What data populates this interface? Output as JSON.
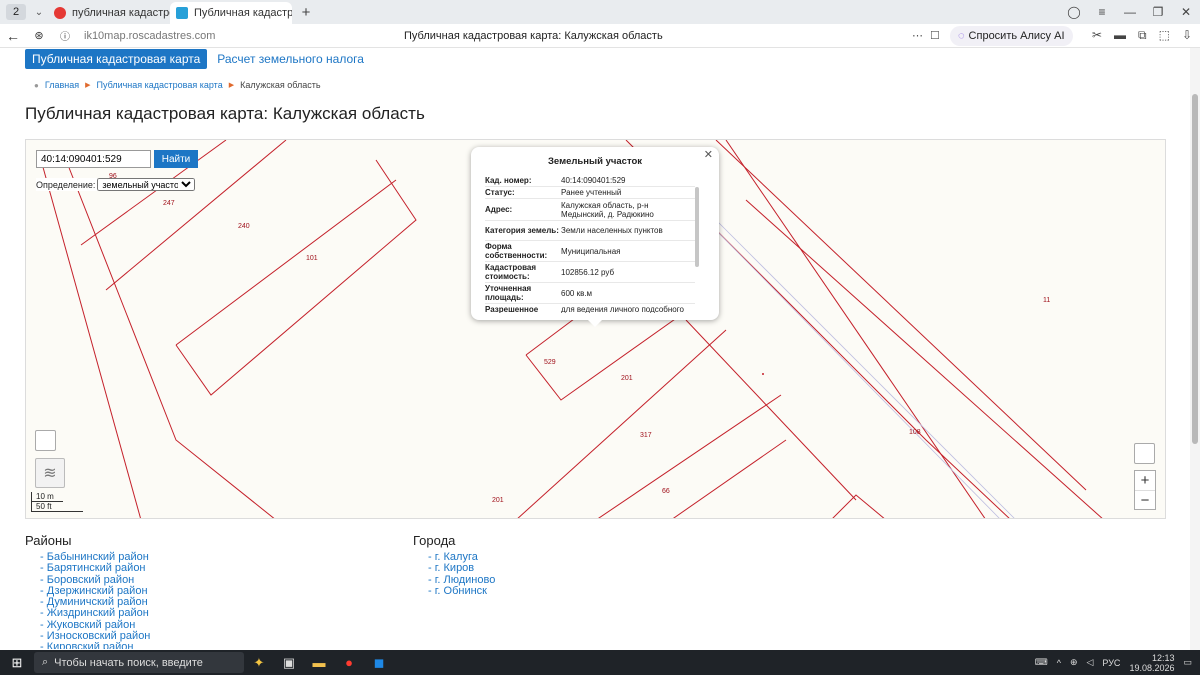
{
  "browser": {
    "tab_counter": "2",
    "tabs": [
      {
        "title": "публичная кадастровая к",
        "active": false
      },
      {
        "title": "Публичная кадастрова",
        "active": true
      }
    ],
    "url": "ik10map.roscadastres.com",
    "page_title": "Публичная кадастровая карта: Калужская область",
    "alisa": "Спросить Алису AI"
  },
  "nav": {
    "main_button": "Публичная кадастровая карта",
    "tax_link": "Расчет земельного налога"
  },
  "breadcrumb": [
    "Главная",
    "Публичная кадастровая карта",
    "Калужская область"
  ],
  "page": {
    "title": "Публичная кадастровая карта: Калужская область"
  },
  "map": {
    "search_value": "40:14:090401:529",
    "search_button": "Найти",
    "definition_label": "Определение:",
    "definition_value": "земельный участок",
    "scale_m": "10 m",
    "scale_ft": "50 ft",
    "parcel_labels": [
      "96",
      "247",
      "240",
      "101",
      "529",
      "201",
      "317",
      "66",
      "201",
      "108",
      "11"
    ],
    "line_color": "#c4202a"
  },
  "popup": {
    "title": "Земельный участок",
    "rows": [
      {
        "key": "Кад. номер:",
        "value": "40:14:090401:529"
      },
      {
        "key": "Статус:",
        "value": "Ранее учтенный"
      },
      {
        "key": "Адрес:",
        "value": "Калужская область, р-н Медынский, д. Радюкино"
      },
      {
        "key": "Категория земель:",
        "value": "Земли населенных пунктов"
      },
      {
        "key": "Форма собственности:",
        "value": "Муниципальная"
      },
      {
        "key": "Кадастровая стоимость:",
        "value": "102856.12 руб"
      },
      {
        "key": "Уточненная площадь:",
        "value": "600 кв.м"
      },
      {
        "key": "Разрешенное",
        "value": "для ведения личного подсобного"
      }
    ]
  },
  "regions": {
    "title": "Районы",
    "items": [
      "Бабынинский район",
      "Барятинский район",
      "Боровский район",
      "Дзержинский район",
      "Думиничский район",
      "Жиздринский район",
      "Жуковский район",
      "Износковский район",
      "Кировский район"
    ]
  },
  "cities": {
    "title": "Города",
    "items": [
      "г. Калуга",
      "г. Киров",
      "г. Людиново",
      "г. Обнинск"
    ]
  },
  "taskbar": {
    "search_placeholder": "Чтобы начать поиск, введите",
    "lang": "РУС",
    "time": "12:13",
    "date": "19.08.2026"
  }
}
